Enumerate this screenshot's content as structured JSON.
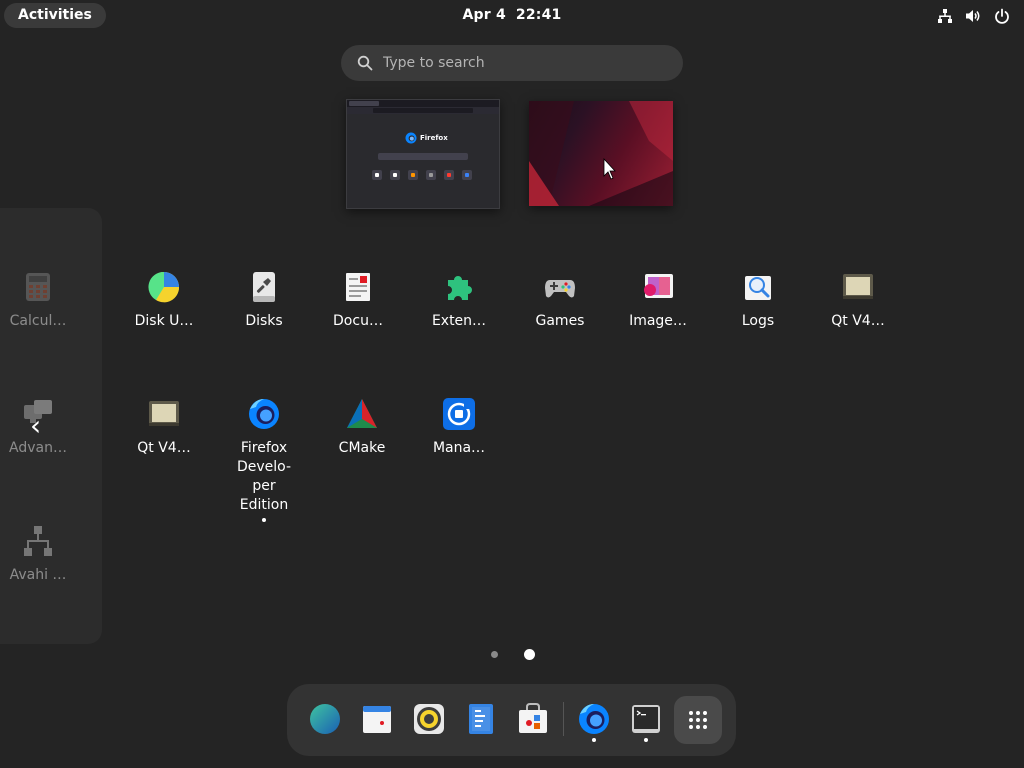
{
  "topbar": {
    "activities_label": "Activities",
    "date": "Apr 4",
    "time": "22:41",
    "tray_icons": [
      "network-wired-icon",
      "volume-icon",
      "power-icon"
    ]
  },
  "search": {
    "placeholder": "Type to search",
    "value": ""
  },
  "windows": [
    {
      "name": "firefox-window",
      "brand_text": "Firefox"
    },
    {
      "name": "desktop-workspace"
    }
  ],
  "prev_page_apps": [
    {
      "label": "Calcul…",
      "icon": "calculator-icon"
    },
    {
      "label": "Advan…",
      "icon": "network-connections-icon"
    },
    {
      "label": "Avahi …",
      "icon": "avahi-network-icon"
    }
  ],
  "apps_row1": [
    {
      "label": "Disk U…",
      "icon": "disk-usage-icon"
    },
    {
      "label": "Disks",
      "icon": "disks-icon"
    },
    {
      "label": "Docu…",
      "icon": "document-viewer-icon"
    },
    {
      "label": "Exten…",
      "icon": "extensions-icon"
    },
    {
      "label": "Games",
      "icon": "gamepad-icon"
    },
    {
      "label": "Image…",
      "icon": "image-viewer-icon"
    },
    {
      "label": "Logs",
      "icon": "logs-icon"
    },
    {
      "label": "Qt V4…",
      "icon": "qt-v4l2-icon"
    }
  ],
  "apps_row2": [
    {
      "label": "Qt V4…",
      "icon": "qt-v4l2-icon"
    },
    {
      "label": "Firefox Develo-per Edition",
      "label_lines": [
        "Firefox",
        "Develo-",
        "per",
        "Edition"
      ],
      "icon": "firefox-developer-icon",
      "running": true
    },
    {
      "label": "CMake",
      "icon": "cmake-icon"
    },
    {
      "label": "Mana…",
      "icon": "manager-icon"
    }
  ],
  "pagination": {
    "current_page": 2,
    "total_pages": 2
  },
  "dash": [
    {
      "icon": "browser-globe-icon",
      "running": false
    },
    {
      "icon": "calendar-icon",
      "running": false
    },
    {
      "icon": "rhythmbox-icon",
      "running": false
    },
    {
      "icon": "text-editor-icon",
      "running": false
    },
    {
      "icon": "software-store-icon",
      "running": false
    },
    {
      "icon": "firefox-developer-icon",
      "running": true
    },
    {
      "icon": "terminal-icon",
      "running": true
    },
    {
      "icon": "show-apps-icon",
      "running": false
    }
  ],
  "colors": {
    "background": "#242424",
    "panel": "#3a3a3a",
    "dash": "#333333",
    "accent": "#ffffff"
  }
}
